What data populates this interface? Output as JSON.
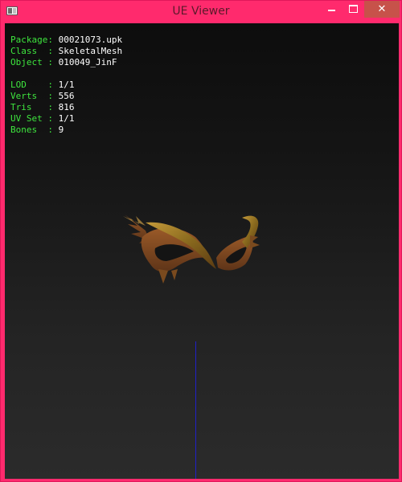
{
  "window": {
    "title": "UE Viewer",
    "close_symbol": "✕",
    "icons": [
      "app-icon",
      "minimize-icon",
      "maximize-icon",
      "close-icon"
    ]
  },
  "info": {
    "package_label": "Package: ",
    "package_value": "00021073.upk",
    "class_label": "Class  : ",
    "class_value": "SkeletalMesh",
    "object_label": "Object : ",
    "object_value": "010049_JinF",
    "lod_label": "LOD    : ",
    "lod_value": "1/1",
    "verts_label": "Verts  : ",
    "verts_value": "556",
    "tris_label": "Tris   : ",
    "tris_value": "816",
    "uvset_label": "UV Set : ",
    "uvset_value": "1/1",
    "bones_label": "Bones  : ",
    "bones_value": "9"
  },
  "colors": {
    "titlebar": "#ff2a6d",
    "close_button": "#c7524a",
    "label_text": "#3ee63e",
    "value_text": "#ffffff",
    "axis": "#2020c8",
    "mask_gold": "#8a6a1e"
  }
}
